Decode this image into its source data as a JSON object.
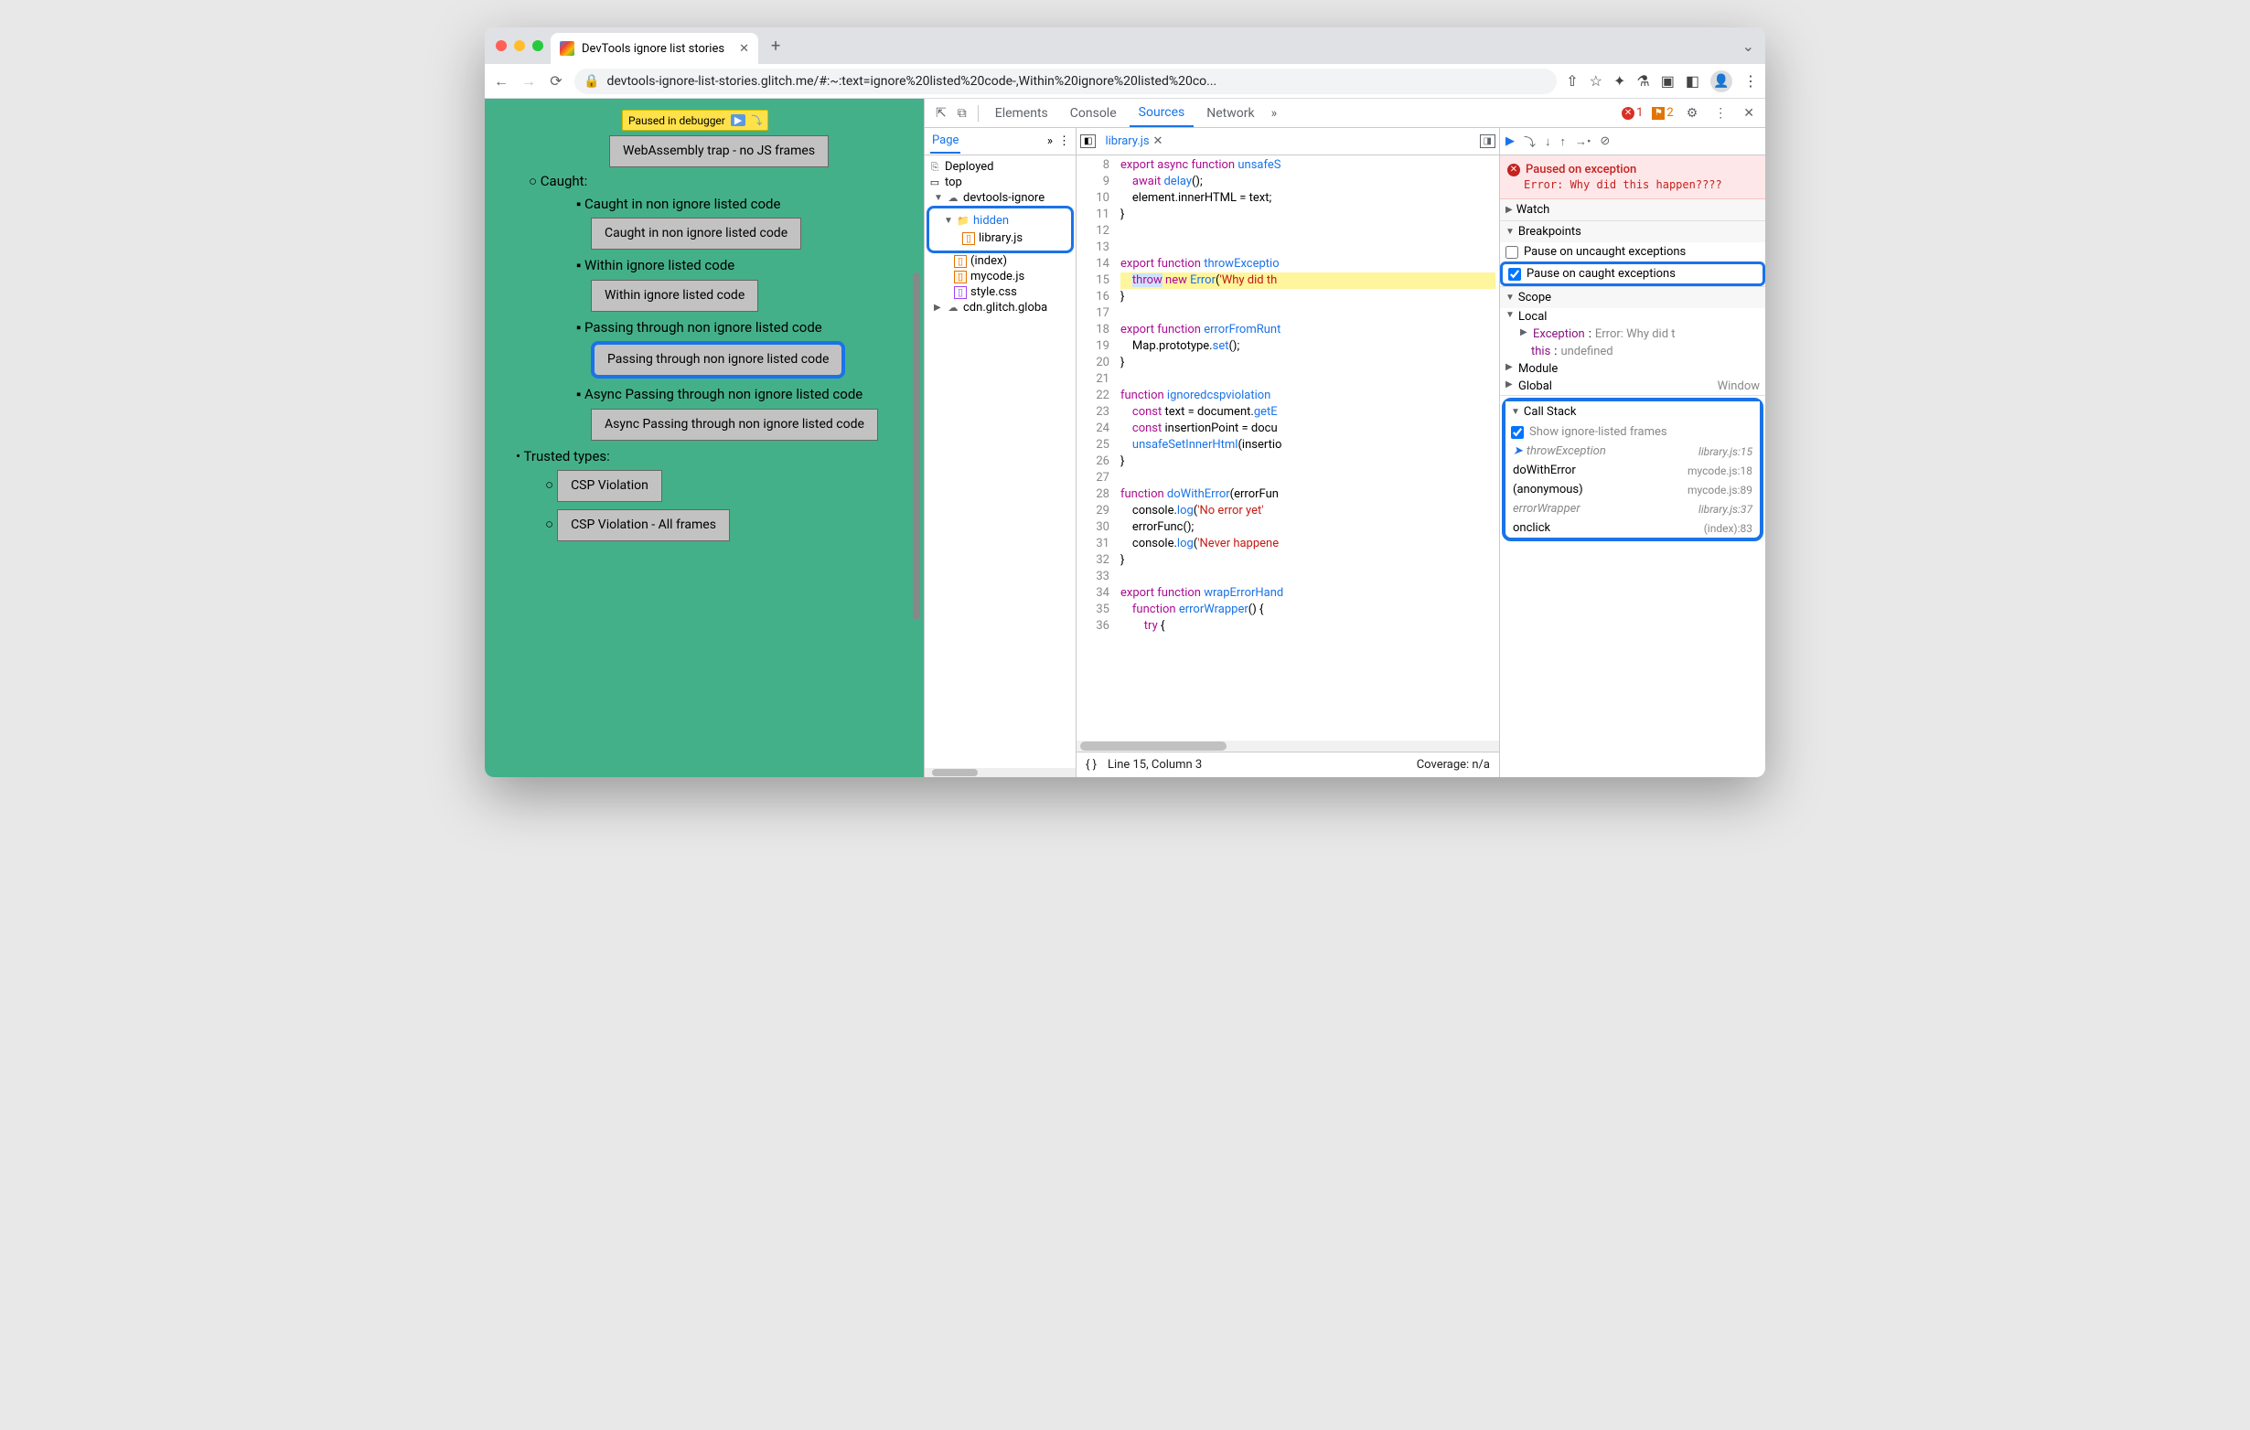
{
  "tab": {
    "title": "DevTools ignore list stories"
  },
  "url": "devtools-ignore-list-stories.glitch.me/#:~:text=ignore%20listed%20code-,Within%20ignore%20listed%20co...",
  "pause_badge": "Paused in debugger",
  "page": {
    "first_btn": "WebAssembly trap - no JS frames",
    "caught_heading": "Caught:",
    "items": [
      {
        "text": "Caught in non ignore listed code",
        "btn": "Caught in non ignore listed code"
      },
      {
        "text": "Within ignore listed code",
        "btn": "Within ignore listed code"
      },
      {
        "text": "Passing through non ignore listed code",
        "btn": "Passing through non ignore listed code",
        "highlight": true
      },
      {
        "text": "Async Passing through non ignore listed code",
        "btn": "Async Passing through non ignore listed code"
      }
    ],
    "trusted_heading": "Trusted types:",
    "csp1": "CSP Violation",
    "csp2": "CSP Violation - All frames"
  },
  "devtools": {
    "tabs": [
      "Elements",
      "Console",
      "Sources",
      "Network"
    ],
    "active_tab": "Sources",
    "errors": "1",
    "issues": "2",
    "sidebar": {
      "page_tab": "Page",
      "deployed": "Deployed",
      "top": "top",
      "cloud1": "devtools-ignore",
      "hidden_folder": "hidden",
      "library": "library.js",
      "index": "(index)",
      "mycode": "mycode.js",
      "style": "style.css",
      "cloud2": "cdn.glitch.globa"
    },
    "editor": {
      "filename": "library.js",
      "lines_start": 8,
      "code_lines": [
        {
          "n": 8,
          "t": "export async function unsafeS"
        },
        {
          "n": 9,
          "t": "    await delay();"
        },
        {
          "n": 10,
          "t": "    element.innerHTML = text;"
        },
        {
          "n": 11,
          "t": "}"
        },
        {
          "n": 12,
          "t": ""
        },
        {
          "n": 13,
          "t": ""
        },
        {
          "n": 14,
          "t": "export function throwExceptio"
        },
        {
          "n": 15,
          "t": "    throw new Error('Why did th"
        },
        {
          "n": 16,
          "t": "}"
        },
        {
          "n": 17,
          "t": ""
        },
        {
          "n": 18,
          "t": "export function errorFromRunt"
        },
        {
          "n": 19,
          "t": "    Map.prototype.set();"
        },
        {
          "n": 20,
          "t": "}"
        },
        {
          "n": 21,
          "t": ""
        },
        {
          "n": 22,
          "t": "function ignoredcspviolation"
        },
        {
          "n": 23,
          "t": "    const text = document.getE"
        },
        {
          "n": 24,
          "t": "    const insertionPoint = docu"
        },
        {
          "n": 25,
          "t": "    unsafeSetInnerHtml(insertio"
        },
        {
          "n": 26,
          "t": "}"
        },
        {
          "n": 27,
          "t": ""
        },
        {
          "n": 28,
          "t": "function doWithError(errorFun"
        },
        {
          "n": 29,
          "t": "    console.log('No error yet'"
        },
        {
          "n": 30,
          "t": "    errorFunc();"
        },
        {
          "n": 31,
          "t": "    console.log('Never happene"
        },
        {
          "n": 32,
          "t": "}"
        },
        {
          "n": 33,
          "t": ""
        },
        {
          "n": 34,
          "t": "export function wrapErrorHand"
        },
        {
          "n": 35,
          "t": "    function errorWrapper() {"
        },
        {
          "n": 36,
          "t": "        try {"
        }
      ],
      "status_line": "Line 15, Column 3",
      "coverage": "Coverage: n/a"
    },
    "debug": {
      "paused_title": "Paused on exception",
      "paused_msg": "Error: Why did this happen????",
      "watch": "Watch",
      "breakpoints": "Breakpoints",
      "bp_uncaught": "Pause on uncaught exceptions",
      "bp_caught": "Pause on caught exceptions",
      "scope": "Scope",
      "local": "Local",
      "exception_label": "Exception",
      "exception_val": "Error: Why did t",
      "this_label": "this",
      "this_val": "undefined",
      "module": "Module",
      "global": "Global",
      "global_val": "Window",
      "callstack": "Call Stack",
      "show_ignored": "Show ignore-listed frames",
      "frames": [
        {
          "name": "throwException",
          "loc": "library.js:15",
          "ignored": true,
          "current": true
        },
        {
          "name": "doWithError",
          "loc": "mycode.js:18"
        },
        {
          "name": "(anonymous)",
          "loc": "mycode.js:89"
        },
        {
          "name": "errorWrapper",
          "loc": "library.js:37",
          "ignored": true
        },
        {
          "name": "onclick",
          "loc": "(index):83"
        }
      ]
    }
  }
}
